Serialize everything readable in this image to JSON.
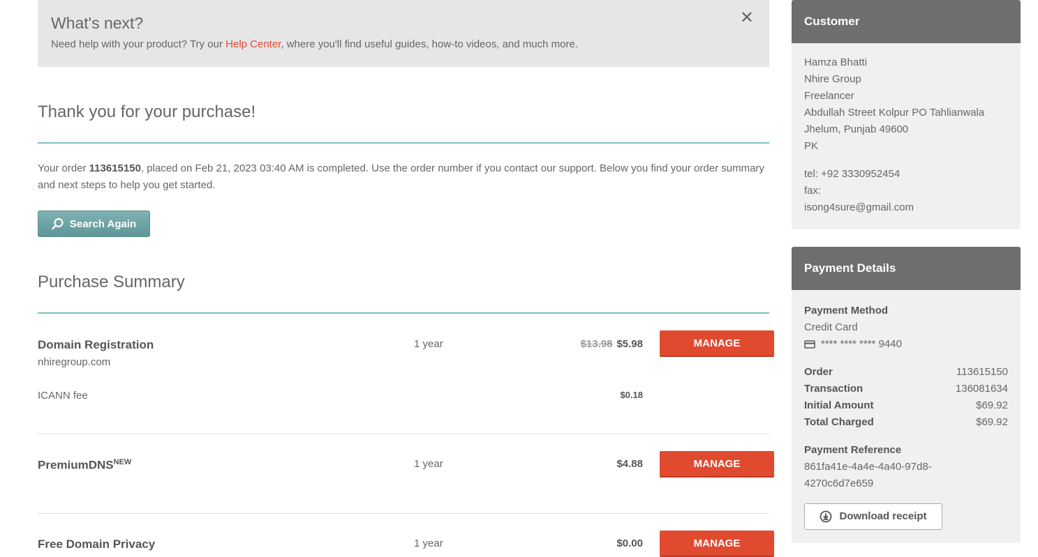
{
  "banner": {
    "title": "What's next?",
    "text_before": "Need help with your product? Try our ",
    "link": "Help Center",
    "text_after": ", where you'll find useful guides, how-to videos, and much more.",
    "close_glyph": "✕"
  },
  "thank_you": "Thank you for your purchase!",
  "order_text": {
    "prefix": "Your order ",
    "order_number": "113615150",
    "suffix": ", placed on Feb 21, 2023 03:40 AM is completed. Use the order number if you contact our support. Below you find your order summary and next steps to help you get started."
  },
  "search_button": "Search Again",
  "purchase_summary_title": "Purchase Summary",
  "items": [
    {
      "name": "Domain Registration",
      "sub": "nhiregroup.com",
      "term": "1 year",
      "old_price": "$13.98",
      "price": "$5.98",
      "action": "MANAGE",
      "fee_label": "ICANN fee",
      "fee_price": "$0.18"
    },
    {
      "name": "PremiumDNS",
      "badge": "NEW",
      "term": "1 year",
      "price": "$4.88",
      "action": "MANAGE"
    },
    {
      "name": "Free Domain Privacy",
      "term": "1 year",
      "price": "$0.00",
      "action": "MANAGE"
    }
  ],
  "customer": {
    "title": "Customer",
    "name": "Hamza Bhatti",
    "company": "Nhire Group",
    "job": "Freelancer",
    "street": "Abdullah Street Kolpur PO Tahlianwala",
    "city": "Jhelum, Punjab 49600",
    "country": "PK",
    "tel": "tel: +92 3330952454",
    "fax": "fax:",
    "email": "isong4sure@gmail.com"
  },
  "payment": {
    "title": "Payment Details",
    "method_label": "Payment Method",
    "method": "Credit Card",
    "card": "**** **** **** 9440",
    "order_label": "Order",
    "order": "113615150",
    "transaction_label": "Transaction",
    "transaction": "136081634",
    "initial_label": "Initial Amount",
    "initial": "$69.92",
    "total_label": "Total Charged",
    "total": "$69.92",
    "reference_label": "Payment Reference",
    "reference_1": "861fa41e-4a4e-4a40-97d8-",
    "reference_2": "4270c6d7e659",
    "download": "Download receipt"
  }
}
